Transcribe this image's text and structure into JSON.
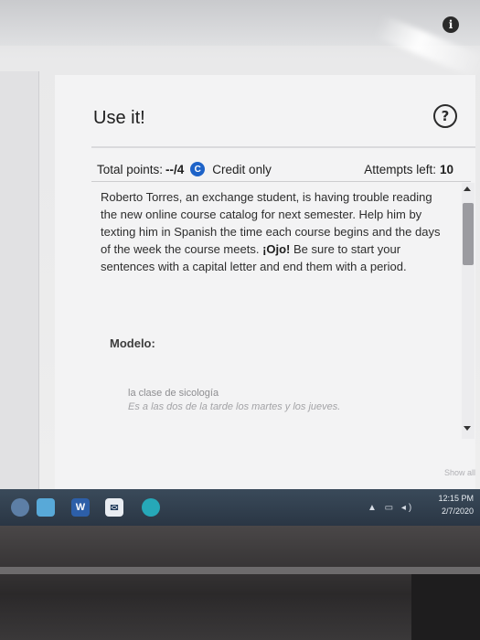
{
  "window": {
    "info_icon": "i"
  },
  "card": {
    "title": "Use it!",
    "help_icon": "?",
    "points_label": "Total points:",
    "points_value": "--/4",
    "credit_badge": "C",
    "credit_label": "Credit only",
    "attempts_label": "Attempts left:",
    "attempts_value": "10"
  },
  "instructions": {
    "text_1": "Roberto Torres, an exchange student, is having trouble reading the new online course catalog for next semester. Help him by texting him in Spanish the time each course begins and the days of the week the course meets.",
    "emphasis": "¡Ojo!",
    "text_2": "Be sure to start your sentences with a capital letter and end them with a period."
  },
  "modelo": {
    "label": "Modelo:",
    "example_prompt": "la clase de sicología",
    "example_answer": "Es a las dos de la tarde los martes y los jueves."
  },
  "show_all": "Show all",
  "taskbar": {
    "time": "12:15 PM",
    "date": "2/7/2020"
  },
  "colors": {
    "accent_blue": "#1e63c8",
    "taskbar": "#2a3644"
  }
}
